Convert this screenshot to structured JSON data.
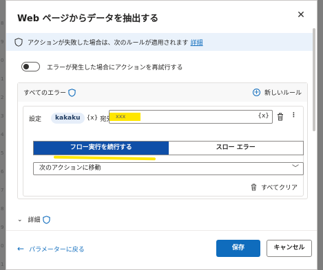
{
  "dialog": {
    "title": "Web ページからデータを抽出する",
    "close_glyph": "✕"
  },
  "banner": {
    "text": "アクションが失敗した場合は、次のルールが適用されます",
    "link": "詳細",
    "icon": "shield-icon"
  },
  "retry": {
    "label": "エラーが発生した場合にアクションを再試行する",
    "enabled": false
  },
  "rules": {
    "header": "すべてのエラー",
    "new_rule": "新しいルール",
    "set_label": "設定",
    "variable": "kakaku",
    "fx": "{x}",
    "dest_label": "宛先",
    "value": "xxx",
    "value_fx": "{x}",
    "more_glyph": "⋮",
    "seg_continue": "フロー実行を続行する",
    "seg_throw": "スロー エラー",
    "dropdown_value": "次のアクションに移動",
    "dropdown_chevron": "﹀",
    "clear_all": "すべてクリア",
    "highlight_color": "#ffe600",
    "active_color": "#0f4fa8"
  },
  "details": {
    "label": "詳細",
    "chevron": "⌄"
  },
  "footer": {
    "back_arrow": "←",
    "back": "パラメーターに戻る",
    "save": "保存",
    "cancel": "キャンセル",
    "accent": "#0f6cbd"
  },
  "background": {
    "numbers": [
      "8",
      "9",
      "0",
      "1",
      "2",
      "3",
      "4",
      "5",
      "6",
      "7",
      "8",
      "9",
      "0",
      "1"
    ]
  }
}
